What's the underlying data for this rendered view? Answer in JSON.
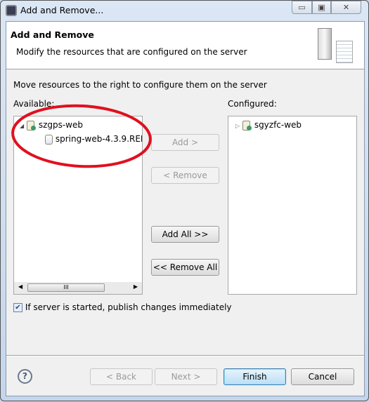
{
  "window": {
    "title": "Add and Remove...",
    "controls": {
      "minimize": "▭",
      "maximize": "▣",
      "close": "✕"
    }
  },
  "header": {
    "title": "Add and Remove",
    "subtitle": "Modify the resources that are configured on the server",
    "icon": "server-icon"
  },
  "instructions": "Move resources to the right to configure them on the server",
  "available": {
    "label": "Available:",
    "items": [
      {
        "label": "szgps-web",
        "expanded": true,
        "children": [
          {
            "label": "spring-web-4.3.9.REI"
          }
        ]
      }
    ],
    "scrollbar_grip": "III"
  },
  "configured": {
    "label": "Configured:",
    "items": [
      {
        "label": "sgyzfc-web",
        "expanded": false
      }
    ]
  },
  "buttons": {
    "add": "Add >",
    "remove": "< Remove",
    "add_all": "Add All >>",
    "remove_all": "<< Remove All"
  },
  "publish_checkbox": {
    "label": "If server is started, publish changes immediately",
    "checked": true
  },
  "footer": {
    "help": "?",
    "back": "< Back",
    "next": "Next >",
    "finish": "Finish",
    "cancel": "Cancel"
  },
  "annotation_color": "#e01020"
}
